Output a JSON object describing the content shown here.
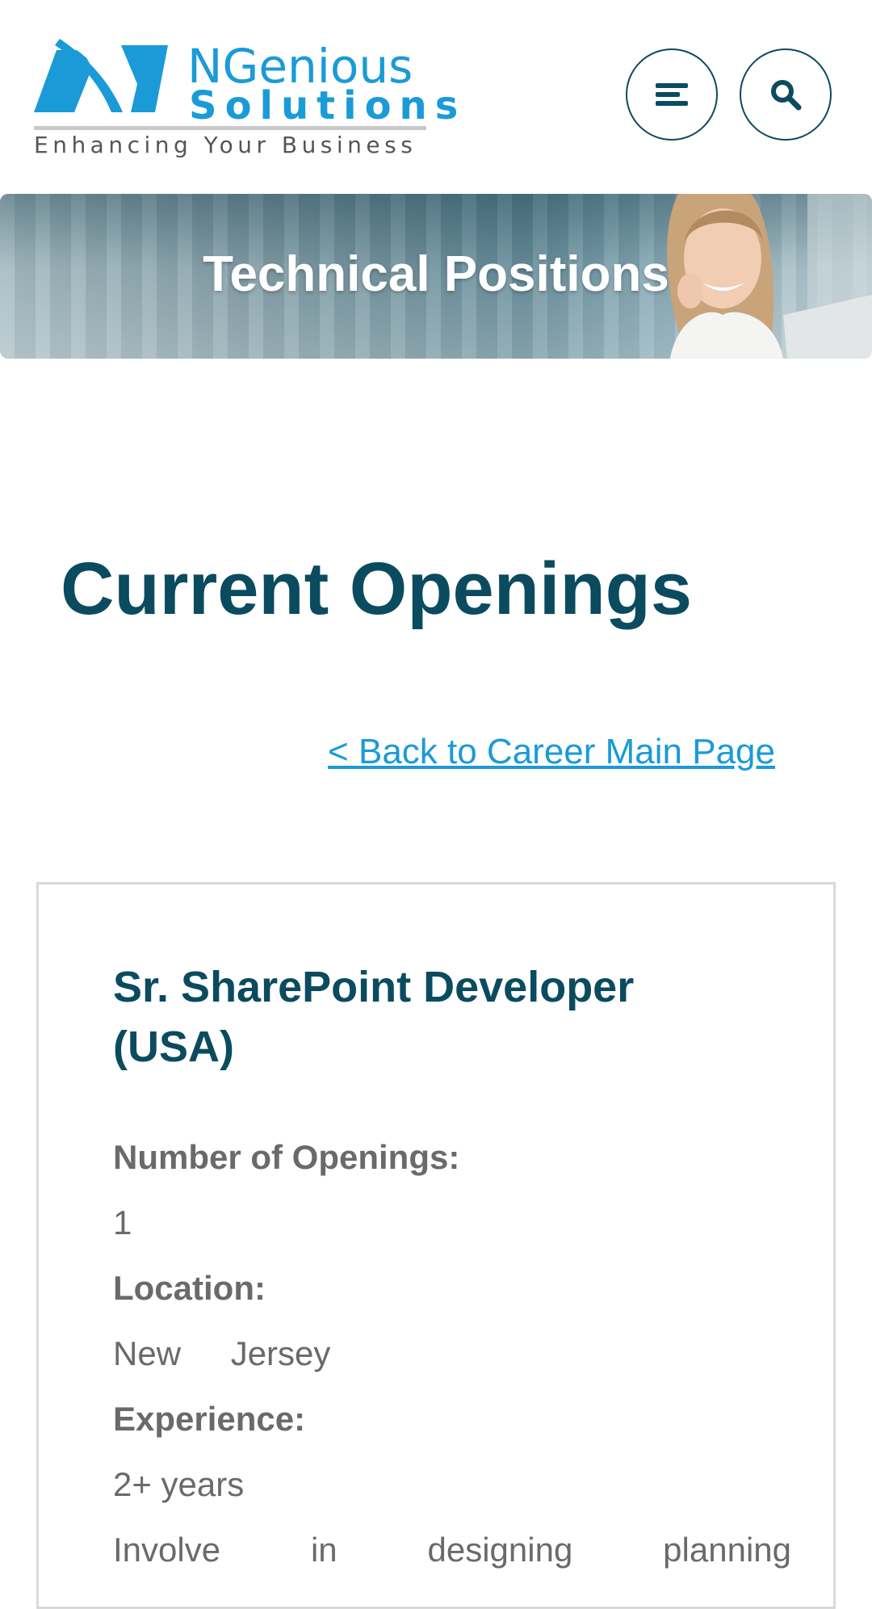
{
  "header": {
    "logo": {
      "name": "NGenious",
      "sub": "Solutions",
      "tagline": "Enhancing Your Business",
      "brand_color": "#1a9bd7"
    },
    "menu_icon": "hamburger-menu-icon",
    "search_icon": "search-icon",
    "button_border_color": "#0b4b5f"
  },
  "banner": {
    "title": "Technical Positions"
  },
  "main": {
    "title": "Current Openings",
    "back_link": "< Back to Career Main Page",
    "title_color": "#0b4b5f",
    "link_color": "#1a9bd7"
  },
  "job": {
    "title": "Sr. SharePoint Developer (USA)",
    "openings_label": "Number of Openings:",
    "openings_value": "1",
    "location_label": "Location:",
    "location_value": "New Jersey",
    "experience_label": "Experience:",
    "experience_value": "2+ years",
    "description_start": "Involve in designing planning"
  }
}
